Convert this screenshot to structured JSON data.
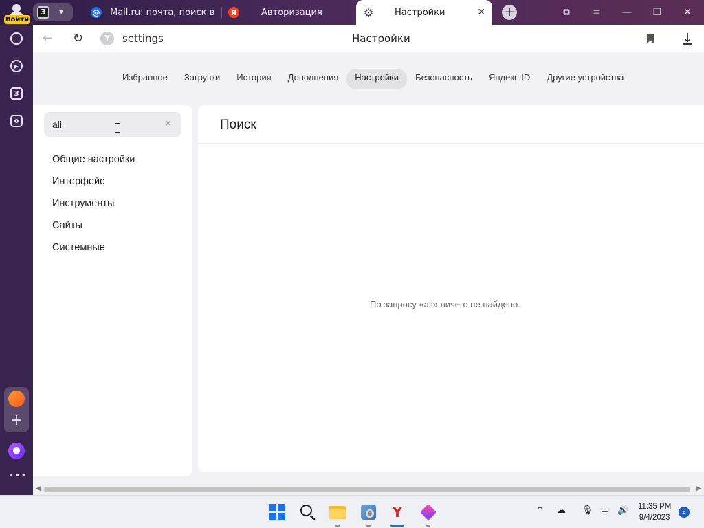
{
  "titlebar": {
    "profile_label": "Войти",
    "tab_count": "3",
    "tabs": [
      {
        "label": "Mail.ru: почта, поиск в ин",
        "icon": "mailru-icon"
      },
      {
        "label": "Авторизация",
        "icon": "yandex-icon",
        "icon_glyph": "Я"
      },
      {
        "label": "Настройки",
        "icon": "gear-icon",
        "active": true
      }
    ]
  },
  "sidebar": {
    "icons": [
      "history-icon",
      "play-icon",
      "zen-icon",
      "screenshot-icon",
      "mail-icon",
      "plus-icon",
      "alice-icon",
      "more-icon"
    ],
    "zen_label": "З"
  },
  "addressbar": {
    "url": "settings",
    "page_title": "Настройки"
  },
  "topnav": {
    "items": [
      "Избранное",
      "Загрузки",
      "История",
      "Дополнения",
      "Настройки",
      "Безопасность",
      "Яндекс ID",
      "Другие устройства"
    ],
    "active": "Настройки"
  },
  "search": {
    "value": "ali"
  },
  "menu": {
    "items": [
      "Общие настройки",
      "Интерфейс",
      "Инструменты",
      "Сайты",
      "Системные"
    ]
  },
  "main": {
    "heading": "Поиск",
    "no_result": "По запросу «ali» ничего не найдено."
  },
  "taskbar": {
    "time": "11:35 PM",
    "date": "9/4/2023",
    "notifications": "2"
  },
  "colors": {
    "sidebar_bg": "#3a2450",
    "accent_yellow": "#ffcc00",
    "taskbar_bg": "#eef0f3"
  }
}
